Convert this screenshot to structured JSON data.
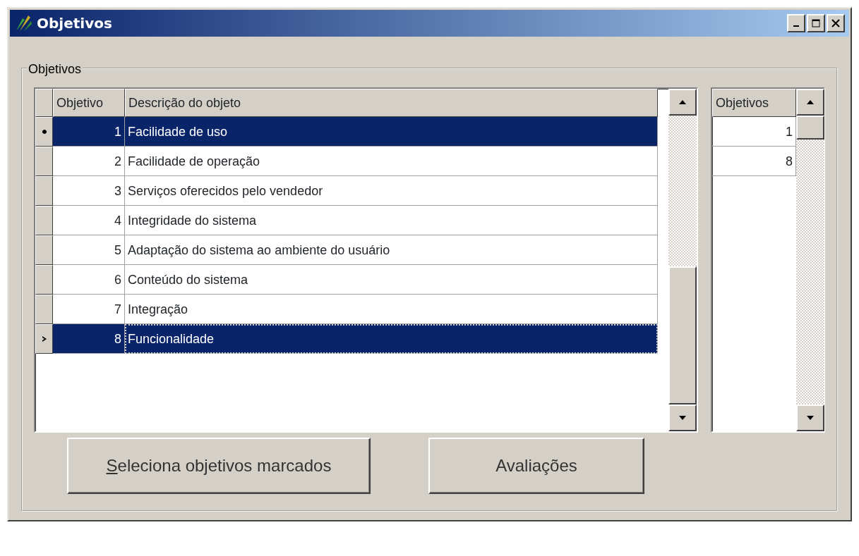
{
  "window": {
    "title": "Objetivos"
  },
  "group": {
    "label": "Objetivos"
  },
  "objectives_table": {
    "columns": [
      "Objetivo",
      "Descrição do objeto"
    ],
    "rows": [
      {
        "number": "1",
        "description": "Facilidade de uso",
        "selected": true,
        "current": false
      },
      {
        "number": "2",
        "description": "Facilidade de operação",
        "selected": false,
        "current": false
      },
      {
        "number": "3",
        "description": "Serviços oferecidos pelo vendedor",
        "selected": false,
        "current": false
      },
      {
        "number": "4",
        "description": "Integridade do sistema",
        "selected": false,
        "current": false
      },
      {
        "number": "5",
        "description": "Adaptação do sistema ao ambiente do usuário",
        "selected": false,
        "current": false
      },
      {
        "number": "6",
        "description": "Conteúdo do sistema",
        "selected": false,
        "current": false
      },
      {
        "number": "7",
        "description": "Integração",
        "selected": false,
        "current": false
      },
      {
        "number": "8",
        "description": "Funcionalidade",
        "selected": true,
        "current": true
      }
    ]
  },
  "selected_table": {
    "columns": [
      "Objetivos"
    ],
    "rows": [
      {
        "number": "1"
      },
      {
        "number": "8"
      }
    ]
  },
  "buttons": [
    {
      "label": "Seleciona objetivos marcados",
      "mnemonic": true
    },
    {
      "label": "Avaliações",
      "mnemonic": false
    }
  ]
}
